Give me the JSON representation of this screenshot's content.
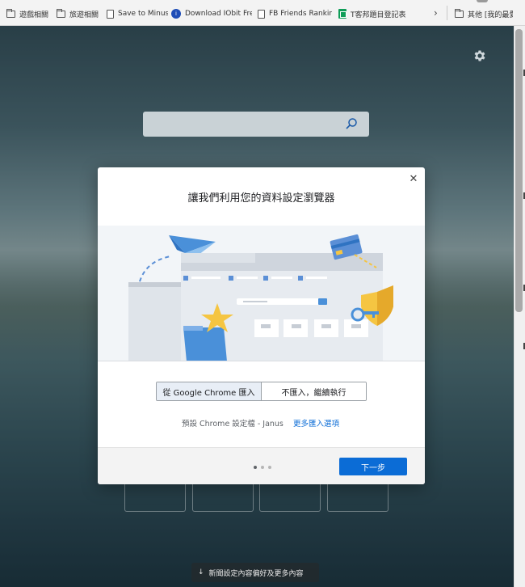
{
  "bookmarks": {
    "items": [
      {
        "label": "遊戲相關",
        "icon": "folder-icon"
      },
      {
        "label": "旅遊相關",
        "icon": "folder-icon"
      },
      {
        "label": "Save to Minus",
        "icon": "page-icon"
      },
      {
        "label": "Download IObit Fre...",
        "icon": "iobit-icon"
      },
      {
        "label": "FB Friends Ranking",
        "icon": "page-icon"
      },
      {
        "label": "T客邦題目登記表",
        "icon": "sheets-icon"
      }
    ],
    "overflow_label": "其他 [我的最愛]"
  },
  "search": {
    "placeholder": ""
  },
  "news_bar": {
    "label": "新聞設定內容偏好及更多內容"
  },
  "dialog": {
    "title": "讓我們利用您的資料設定瀏覽器",
    "import_options": [
      {
        "label": "從 Google Chrome 匯入",
        "selected": true
      },
      {
        "label": "不匯入，繼續執行",
        "selected": false
      }
    ],
    "profile_text": "預設 Chrome 設定檔 - Janus",
    "more_options_link": "更多匯入選項",
    "next_button": "下一步",
    "step_indicator": {
      "current": 1,
      "total": 3
    }
  },
  "colors": {
    "accent": "#0b6cd6",
    "selected_segment": "#e8eef6"
  }
}
